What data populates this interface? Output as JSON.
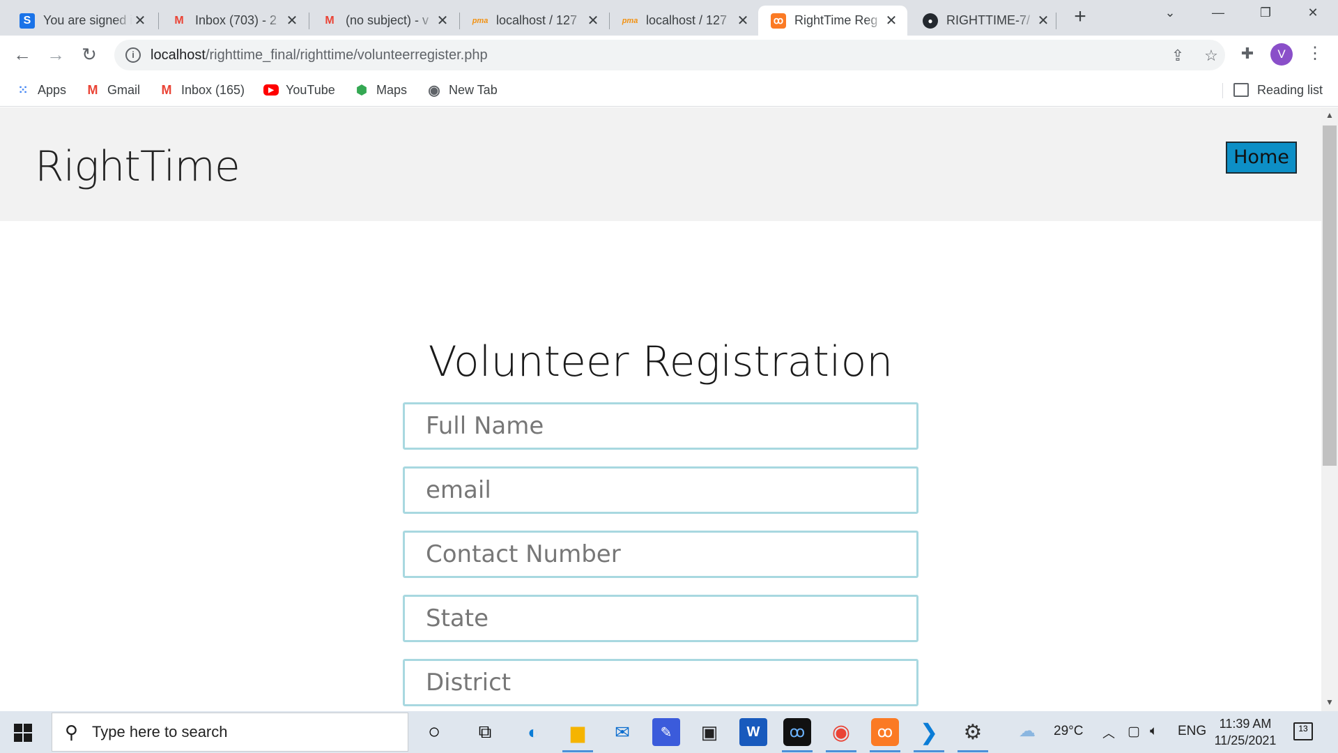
{
  "tabs": [
    {
      "title": "You are signed in",
      "favicon": "S",
      "color": "#1a73e8"
    },
    {
      "title": "Inbox (703) - 2",
      "favicon": "M",
      "color": "#ea4335"
    },
    {
      "title": "(no subject) - v",
      "favicon": "M",
      "color": "#ea4335"
    },
    {
      "title": "localhost / 127",
      "favicon": "pma",
      "color": "#f29111"
    },
    {
      "title": "localhost / 127",
      "favicon": "pma",
      "color": "#f29111"
    },
    {
      "title": "RightTime Reg",
      "favicon": "xampp",
      "color": "#fb7a24"
    },
    {
      "title": "RIGHTTIME-7/",
      "favicon": "github",
      "color": "#24292f"
    }
  ],
  "address": {
    "host": "localhost",
    "path": "/righttime_final/righttime/volunteerregister.php"
  },
  "profile_initial": "V",
  "bookmarks": [
    {
      "label": "Apps",
      "icon": "apps-grid-icon"
    },
    {
      "label": "Gmail",
      "icon": "gmail-icon"
    },
    {
      "label": "Inbox (165)",
      "icon": "gmail-icon"
    },
    {
      "label": "YouTube",
      "icon": "youtube-icon"
    },
    {
      "label": "Maps",
      "icon": "maps-icon"
    },
    {
      "label": "New Tab",
      "icon": "globe-icon"
    }
  ],
  "reading_list": "Reading list",
  "site": {
    "brand": "RightTime",
    "home": "Home",
    "form_title": "Volunteer Registration",
    "fields": [
      {
        "placeholder": "Full Name"
      },
      {
        "placeholder": "email"
      },
      {
        "placeholder": "Contact Number"
      },
      {
        "placeholder": "State"
      },
      {
        "placeholder": "District"
      }
    ]
  },
  "taskbar": {
    "search_placeholder": "Type here to search",
    "weather": "29°C",
    "language": "ENG",
    "time": "11:39 AM",
    "date": "11/25/2021",
    "notifications": "13"
  }
}
